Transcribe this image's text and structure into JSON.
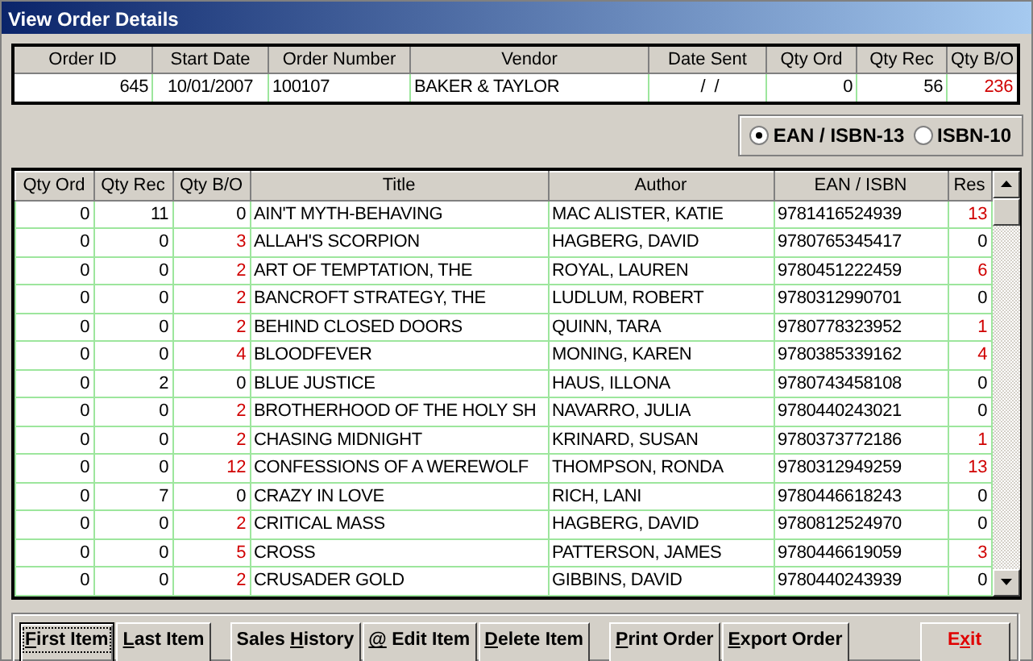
{
  "window": {
    "title": "View Order Details"
  },
  "order": {
    "columns": [
      "Order ID",
      "Start Date",
      "Order Number",
      "Vendor",
      "Date Sent",
      "Qty Ord",
      "Qty Rec",
      "Qty B/O"
    ],
    "row": [
      {
        "text": "645",
        "highlight": false
      },
      {
        "text": "10/01/2007",
        "highlight": false
      },
      {
        "text": "100107",
        "highlight": false
      },
      {
        "text": "BAKER & TAYLOR",
        "highlight": false
      },
      {
        "text": " /  /",
        "highlight": false
      },
      {
        "text": "0",
        "highlight": false
      },
      {
        "text": "56",
        "highlight": false
      },
      {
        "text": "236",
        "highlight": true
      }
    ]
  },
  "isbn_format": [
    {
      "label": "EAN / ISBN-13",
      "selected": true
    },
    {
      "label": "ISBN-10",
      "selected": false
    }
  ],
  "items": {
    "columns": [
      "Qty Ord",
      "Qty Rec",
      "Qty B/O",
      "Title",
      "Author",
      "EAN / ISBN",
      "Res"
    ],
    "rows": [
      {
        "qty_ord": "0",
        "qty_rec": "11",
        "qty_bo": "0",
        "bo_highlight": false,
        "title": "AIN'T MYTH-BEHAVING",
        "author": "MAC ALISTER, KATIE",
        "isbn": "9781416524939",
        "res": "13",
        "res_highlight": true
      },
      {
        "qty_ord": "0",
        "qty_rec": "0",
        "qty_bo": "3",
        "bo_highlight": true,
        "title": "ALLAH'S SCORPION",
        "author": "HAGBERG, DAVID",
        "isbn": "9780765345417",
        "res": "0",
        "res_highlight": false
      },
      {
        "qty_ord": "0",
        "qty_rec": "0",
        "qty_bo": "2",
        "bo_highlight": true,
        "title": "ART OF TEMPTATION, THE",
        "author": "ROYAL, LAUREN",
        "isbn": "9780451222459",
        "res": "6",
        "res_highlight": true
      },
      {
        "qty_ord": "0",
        "qty_rec": "0",
        "qty_bo": "2",
        "bo_highlight": true,
        "title": "BANCROFT STRATEGY, THE",
        "author": "LUDLUM, ROBERT",
        "isbn": "9780312990701",
        "res": "0",
        "res_highlight": false
      },
      {
        "qty_ord": "0",
        "qty_rec": "0",
        "qty_bo": "2",
        "bo_highlight": true,
        "title": "BEHIND CLOSED DOORS",
        "author": "QUINN, TARA",
        "isbn": "9780778323952",
        "res": "1",
        "res_highlight": true
      },
      {
        "qty_ord": "0",
        "qty_rec": "0",
        "qty_bo": "4",
        "bo_highlight": true,
        "title": "BLOODFEVER",
        "author": "MONING, KAREN",
        "isbn": "9780385339162",
        "res": "4",
        "res_highlight": true
      },
      {
        "qty_ord": "0",
        "qty_rec": "2",
        "qty_bo": "0",
        "bo_highlight": false,
        "title": "BLUE JUSTICE",
        "author": "HAUS, ILLONA",
        "isbn": "9780743458108",
        "res": "0",
        "res_highlight": false
      },
      {
        "qty_ord": "0",
        "qty_rec": "0",
        "qty_bo": "2",
        "bo_highlight": true,
        "title": "BROTHERHOOD OF THE HOLY SH",
        "author": "NAVARRO, JULIA",
        "isbn": "9780440243021",
        "res": "0",
        "res_highlight": false
      },
      {
        "qty_ord": "0",
        "qty_rec": "0",
        "qty_bo": "2",
        "bo_highlight": true,
        "title": "CHASING MIDNIGHT",
        "author": "KRINARD, SUSAN",
        "isbn": "9780373772186",
        "res": "1",
        "res_highlight": true
      },
      {
        "qty_ord": "0",
        "qty_rec": "0",
        "qty_bo": "12",
        "bo_highlight": true,
        "title": "CONFESSIONS OF A WEREWOLF",
        "author": "THOMPSON, RONDA",
        "isbn": "9780312949259",
        "res": "13",
        "res_highlight": true
      },
      {
        "qty_ord": "0",
        "qty_rec": "7",
        "qty_bo": "0",
        "bo_highlight": false,
        "title": "CRAZY IN LOVE",
        "author": "RICH, LANI",
        "isbn": "9780446618243",
        "res": "0",
        "res_highlight": false
      },
      {
        "qty_ord": "0",
        "qty_rec": "0",
        "qty_bo": "2",
        "bo_highlight": true,
        "title": "CRITICAL MASS",
        "author": "HAGBERG, DAVID",
        "isbn": "9780812524970",
        "res": "0",
        "res_highlight": false
      },
      {
        "qty_ord": "0",
        "qty_rec": "0",
        "qty_bo": "5",
        "bo_highlight": true,
        "title": "CROSS",
        "author": "PATTERSON, JAMES",
        "isbn": "9780446619059",
        "res": "3",
        "res_highlight": true
      },
      {
        "qty_ord": "0",
        "qty_rec": "0",
        "qty_bo": "2",
        "bo_highlight": true,
        "title": "CRUSADER GOLD",
        "author": "GIBBINS, DAVID",
        "isbn": "9780440243939",
        "res": "0",
        "res_highlight": false
      }
    ]
  },
  "button_groups": [
    [
      {
        "hotkey": "F",
        "after": "irst Item",
        "focused": true,
        "danger": false
      },
      {
        "hotkey": "L",
        "after": "ast Item",
        "focused": false,
        "danger": false
      }
    ],
    [
      {
        "before": "Sales ",
        "hotkey": "H",
        "after": "istory",
        "focused": false,
        "danger": false
      },
      {
        "hotkey": "@",
        "after": " Edit Item",
        "focused": false,
        "danger": false
      },
      {
        "hotkey": "D",
        "after": "elete Item",
        "focused": false,
        "danger": false
      }
    ],
    [
      {
        "hotkey": "P",
        "after": "rint Order",
        "focused": false,
        "danger": false
      },
      {
        "hotkey": "E",
        "after": "xport Order",
        "focused": false,
        "danger": false
      }
    ],
    [
      {
        "before": "E",
        "hotkey": "x",
        "after": "it",
        "focused": false,
        "danger": true
      }
    ]
  ]
}
